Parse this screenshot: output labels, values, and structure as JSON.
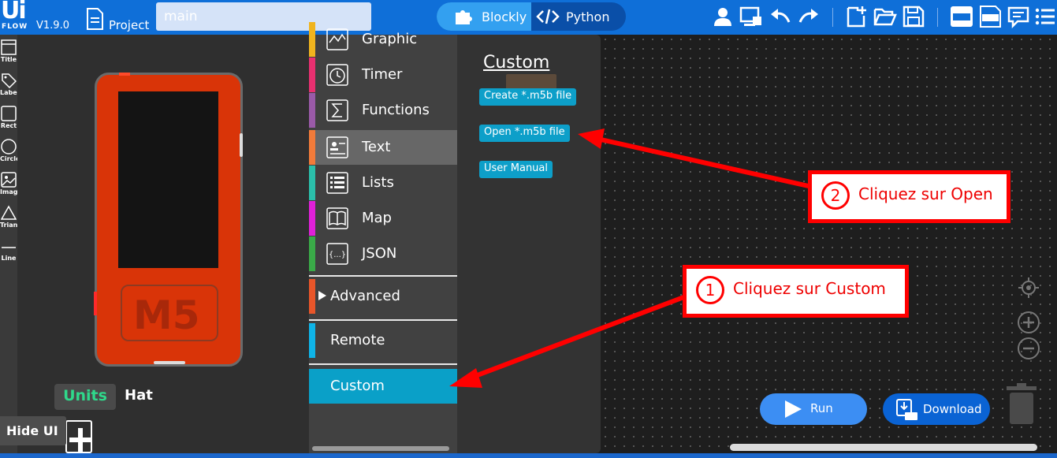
{
  "app": {
    "logo": "Ui",
    "logo_sub": "FLOW",
    "version": "V1.9.0",
    "project_label": "Project",
    "file_name": "main"
  },
  "mode": {
    "blockly": "Blockly",
    "python": "Python"
  },
  "tools": [
    "Title",
    "Label",
    "Rect",
    "Circle",
    "Image",
    "Triangle",
    "Line"
  ],
  "device": {
    "logo": "M5"
  },
  "panel_tabs": {
    "units": "Units",
    "hat": "Hat"
  },
  "hide_ui": "Hide UI",
  "categories": [
    {
      "label": "Graphic",
      "color": "#f0b41e"
    },
    {
      "label": "Timer",
      "color": "#e83070"
    },
    {
      "label": "Functions",
      "color": "#9a5aa8"
    },
    {
      "label": "Text",
      "color": "#f27b3a"
    },
    {
      "label": "Lists",
      "color": "#2bbfaa"
    },
    {
      "label": "Map",
      "color": "#e020d8"
    },
    {
      "label": "JSON",
      "color": "#3aaa48"
    }
  ],
  "advanced": {
    "label": "Advanced",
    "color": "#e8562a"
  },
  "remote": {
    "label": "Remote",
    "color": "#0fb4e8"
  },
  "custom": {
    "label": "Custom",
    "color": "#0aa0c8"
  },
  "flyout": {
    "title": "Custom",
    "buttons": [
      "Create *.m5b file",
      "Open *.m5b file",
      "User Manual"
    ]
  },
  "workspace": {
    "run": "Run",
    "download": "Download"
  },
  "annotations": {
    "step1": {
      "num": "1",
      "text": "Cliquez sur Custom"
    },
    "step2": {
      "num": "2",
      "text": "Cliquez sur Open"
    }
  },
  "colors": {
    "topbar": "#0f6fd8",
    "accent": "#33a0f0",
    "annotation": "#ff0000"
  }
}
